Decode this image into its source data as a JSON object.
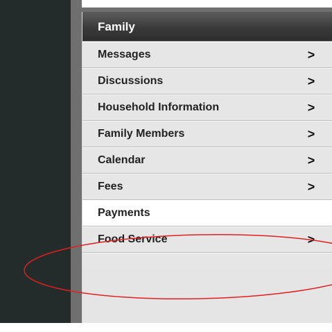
{
  "menu": {
    "header": "Family",
    "items": [
      {
        "label": "Messages",
        "chevron": ">"
      },
      {
        "label": "Discussions",
        "chevron": ">"
      },
      {
        "label": "Household Information",
        "chevron": ">"
      },
      {
        "label": "Family Members",
        "chevron": ">"
      },
      {
        "label": "Calendar",
        "chevron": ">"
      },
      {
        "label": "Fees",
        "chevron": ">"
      },
      {
        "label": "Payments",
        "chevron": ""
      },
      {
        "label": "Food Service",
        "chevron": ">"
      }
    ]
  },
  "annotation": {
    "shape": "ellipse",
    "color": "#e02020",
    "target": "Payments"
  },
  "colors": {
    "sidebar_dark": "#242b2b",
    "menu_header": "#3a3a3a",
    "menu_item_bg": "#e6e6e6",
    "active_item_bg": "#ffffff"
  }
}
